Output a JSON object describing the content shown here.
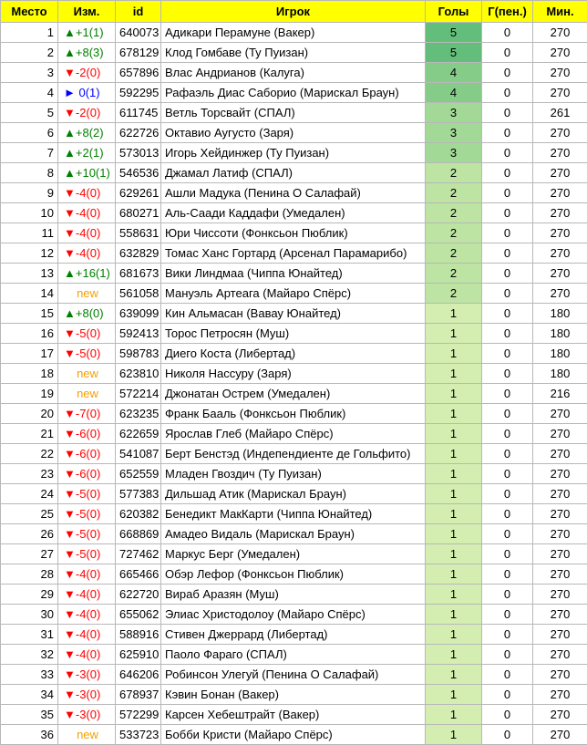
{
  "headers": {
    "rank": "Место",
    "change": "Изм.",
    "id": "id",
    "player": "Игрок",
    "goals": "Голы",
    "pen": "Г(пен.)",
    "min": "Мин."
  },
  "colors": {
    "header_bg": "#ffff00",
    "up": "#008000",
    "down": "#ff0000",
    "same": "#0000ff",
    "new": "#f4a000",
    "goals_5": "#63be7b",
    "goals_4": "#85cc88",
    "goals_3": "#a3d996",
    "goals_2": "#bde4a2",
    "goals_1": "#d3eeb0"
  },
  "rows": [
    {
      "rank": "1",
      "change": "▲+1(1)",
      "dir": "up",
      "id": "640073",
      "player": "Адикари Перамуне (Вакер)",
      "goals": "5",
      "pen": "0",
      "min": "270"
    },
    {
      "rank": "2",
      "change": "▲+8(3)",
      "dir": "up",
      "id": "678129",
      "player": "Клод Гомбаве (Ту Пуизан)",
      "goals": "5",
      "pen": "0",
      "min": "270"
    },
    {
      "rank": "3",
      "change": "▼-2(0)",
      "dir": "down",
      "id": "657896",
      "player": "Влас Андрианов (Калуга)",
      "goals": "4",
      "pen": "0",
      "min": "270"
    },
    {
      "rank": "4",
      "change": "► 0(1)",
      "dir": "same",
      "id": "592295",
      "player": "Рафаэль Диас Саборио (Марискал Браун)",
      "goals": "4",
      "pen": "0",
      "min": "270"
    },
    {
      "rank": "5",
      "change": "▼-2(0)",
      "dir": "down",
      "id": "611745",
      "player": "Ветль Торсвайт (СПАЛ)",
      "goals": "3",
      "pen": "0",
      "min": "261"
    },
    {
      "rank": "6",
      "change": "▲+8(2)",
      "dir": "up",
      "id": "622726",
      "player": "Октавио Аугусто (Заря)",
      "goals": "3",
      "pen": "0",
      "min": "270"
    },
    {
      "rank": "7",
      "change": "▲+2(1)",
      "dir": "up",
      "id": "573013",
      "player": "Игорь Хейдинжер (Ту Пуизан)",
      "goals": "3",
      "pen": "0",
      "min": "270"
    },
    {
      "rank": "8",
      "change": "▲+10(1)",
      "dir": "up",
      "id": "546536",
      "player": "Джамал Латиф (СПАЛ)",
      "goals": "2",
      "pen": "0",
      "min": "270"
    },
    {
      "rank": "9",
      "change": "▼-4(0)",
      "dir": "down",
      "id": "629261",
      "player": "Ашли Мадука (Пенина О Салафай)",
      "goals": "2",
      "pen": "0",
      "min": "270"
    },
    {
      "rank": "10",
      "change": "▼-4(0)",
      "dir": "down",
      "id": "680271",
      "player": "Аль-Саади Каддафи (Умедален)",
      "goals": "2",
      "pen": "0",
      "min": "270"
    },
    {
      "rank": "11",
      "change": "▼-4(0)",
      "dir": "down",
      "id": "558631",
      "player": "Юри Чиссоти (Фонксьон Пюблик)",
      "goals": "2",
      "pen": "0",
      "min": "270"
    },
    {
      "rank": "12",
      "change": "▼-4(0)",
      "dir": "down",
      "id": "632829",
      "player": "Томас Ханс Гортард (Арсенал Парамарибо)",
      "goals": "2",
      "pen": "0",
      "min": "270"
    },
    {
      "rank": "13",
      "change": "▲+16(1)",
      "dir": "up",
      "id": "681673",
      "player": "Вики Линдмаа (Чиппа Юнайтед)",
      "goals": "2",
      "pen": "0",
      "min": "270"
    },
    {
      "rank": "14",
      "change": "new",
      "dir": "new",
      "id": "561058",
      "player": "Мануэль Артеага (Майаро Спёрс)",
      "goals": "2",
      "pen": "0",
      "min": "270"
    },
    {
      "rank": "15",
      "change": "▲+8(0)",
      "dir": "up",
      "id": "639099",
      "player": "Кин Альмасан (Вавау Юнайтед)",
      "goals": "1",
      "pen": "0",
      "min": "180"
    },
    {
      "rank": "16",
      "change": "▼-5(0)",
      "dir": "down",
      "id": "592413",
      "player": "Торос Петросян (Муш)",
      "goals": "1",
      "pen": "0",
      "min": "180"
    },
    {
      "rank": "17",
      "change": "▼-5(0)",
      "dir": "down",
      "id": "598783",
      "player": "Диего Коста (Либертад)",
      "goals": "1",
      "pen": "0",
      "min": "180"
    },
    {
      "rank": "18",
      "change": "new",
      "dir": "new",
      "id": "623810",
      "player": "Николя Нассуру (Заря)",
      "goals": "1",
      "pen": "0",
      "min": "180"
    },
    {
      "rank": "19",
      "change": "new",
      "dir": "new",
      "id": "572214",
      "player": "Джонатан Острем (Умедален)",
      "goals": "1",
      "pen": "0",
      "min": "216"
    },
    {
      "rank": "20",
      "change": "▼-7(0)",
      "dir": "down",
      "id": "623235",
      "player": "Франк Бааль (Фонксьон Пюблик)",
      "goals": "1",
      "pen": "0",
      "min": "270"
    },
    {
      "rank": "21",
      "change": "▼-6(0)",
      "dir": "down",
      "id": "622659",
      "player": "Ярослав Глеб (Майаро Спёрс)",
      "goals": "1",
      "pen": "0",
      "min": "270"
    },
    {
      "rank": "22",
      "change": "▼-6(0)",
      "dir": "down",
      "id": "541087",
      "player": "Берт Бенстэд (Индепендиенте де Гольфито)",
      "goals": "1",
      "pen": "0",
      "min": "270"
    },
    {
      "rank": "23",
      "change": "▼-6(0)",
      "dir": "down",
      "id": "652559",
      "player": "Младен Гвоздич (Ту Пуизан)",
      "goals": "1",
      "pen": "0",
      "min": "270"
    },
    {
      "rank": "24",
      "change": "▼-5(0)",
      "dir": "down",
      "id": "577383",
      "player": "Дильшад Атик (Марискал Браун)",
      "goals": "1",
      "pen": "0",
      "min": "270"
    },
    {
      "rank": "25",
      "change": "▼-5(0)",
      "dir": "down",
      "id": "620382",
      "player": "Бенедикт МакКарти (Чиппа Юнайтед)",
      "goals": "1",
      "pen": "0",
      "min": "270"
    },
    {
      "rank": "26",
      "change": "▼-5(0)",
      "dir": "down",
      "id": "668869",
      "player": "Амадео Видаль (Марискал Браун)",
      "goals": "1",
      "pen": "0",
      "min": "270"
    },
    {
      "rank": "27",
      "change": "▼-5(0)",
      "dir": "down",
      "id": "727462",
      "player": "Маркус Берг (Умедален)",
      "goals": "1",
      "pen": "0",
      "min": "270"
    },
    {
      "rank": "28",
      "change": "▼-4(0)",
      "dir": "down",
      "id": "665466",
      "player": "Обэр Лефор (Фонксьон Пюблик)",
      "goals": "1",
      "pen": "0",
      "min": "270"
    },
    {
      "rank": "29",
      "change": "▼-4(0)",
      "dir": "down",
      "id": "622720",
      "player": "Вираб Аразян (Муш)",
      "goals": "1",
      "pen": "0",
      "min": "270"
    },
    {
      "rank": "30",
      "change": "▼-4(0)",
      "dir": "down",
      "id": "655062",
      "player": "Элиас Христодолоу (Майаро Спёрс)",
      "goals": "1",
      "pen": "0",
      "min": "270"
    },
    {
      "rank": "31",
      "change": "▼-4(0)",
      "dir": "down",
      "id": "588916",
      "player": "Стивен Джеррард (Либертад)",
      "goals": "1",
      "pen": "0",
      "min": "270"
    },
    {
      "rank": "32",
      "change": "▼-4(0)",
      "dir": "down",
      "id": "625910",
      "player": "Паоло Фараго (СПАЛ)",
      "goals": "1",
      "pen": "0",
      "min": "270"
    },
    {
      "rank": "33",
      "change": "▼-3(0)",
      "dir": "down",
      "id": "646206",
      "player": "Робинсон Улегуй (Пенина О Салафай)",
      "goals": "1",
      "pen": "0",
      "min": "270"
    },
    {
      "rank": "34",
      "change": "▼-3(0)",
      "dir": "down",
      "id": "678937",
      "player": "Кэвин Бонан (Вакер)",
      "goals": "1",
      "pen": "0",
      "min": "270"
    },
    {
      "rank": "35",
      "change": "▼-3(0)",
      "dir": "down",
      "id": "572299",
      "player": "Карсен Хебештрайт (Вакер)",
      "goals": "1",
      "pen": "0",
      "min": "270"
    },
    {
      "rank": "36",
      "change": "new",
      "dir": "new",
      "id": "533723",
      "player": "Бобби Кристи (Майаро Спёрс)",
      "goals": "1",
      "pen": "0",
      "min": "270"
    }
  ]
}
